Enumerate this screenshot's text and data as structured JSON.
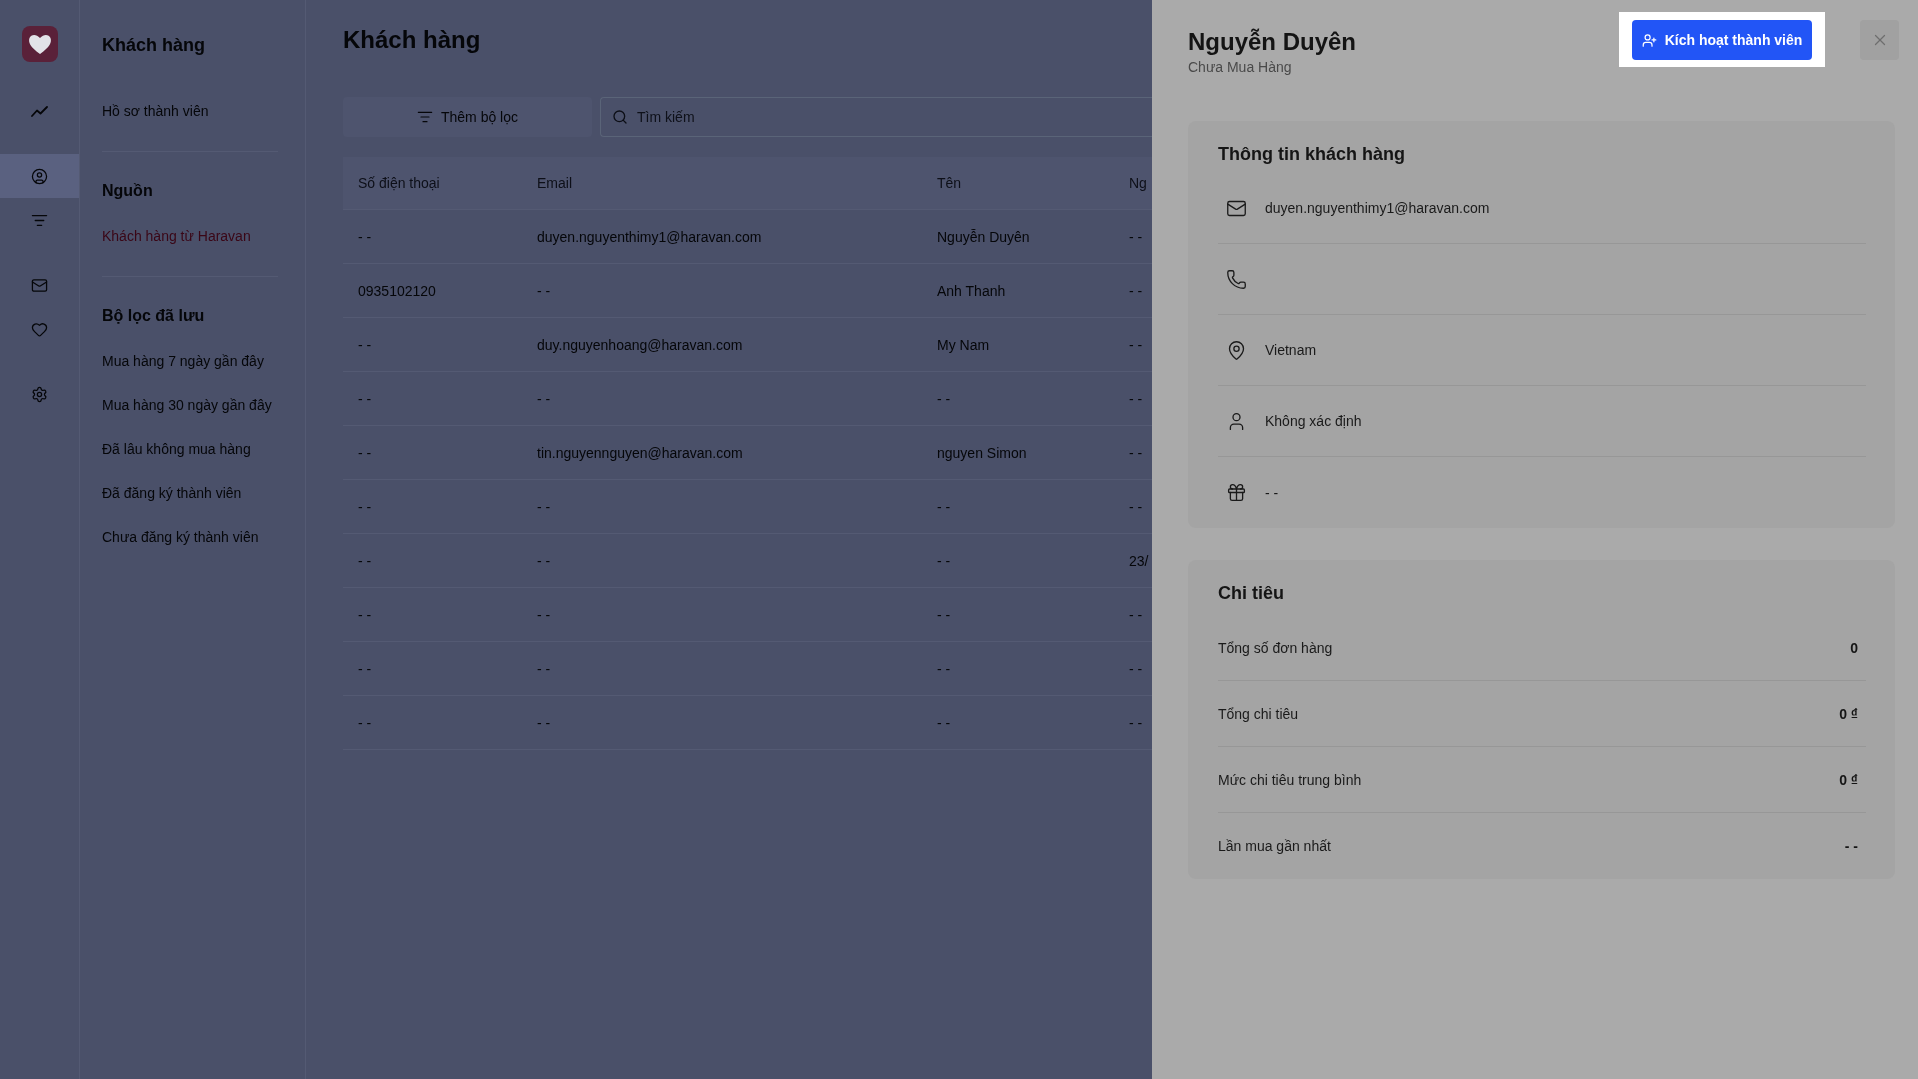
{
  "rail": {
    "groups": [
      {
        "items": [
          {
            "selected": false
          }
        ]
      },
      {
        "items": [
          {
            "selected": true
          },
          {
            "selected": false
          }
        ]
      },
      {
        "items": [
          {
            "selected": false
          },
          {
            "selected": false
          }
        ]
      },
      {
        "items": [
          {
            "selected": false
          }
        ]
      }
    ]
  },
  "nav": {
    "title": "Khách hàng",
    "sections": [
      {
        "items": [
          {
            "label": "Hồ sơ thành viên",
            "selected": false
          }
        ]
      },
      {
        "heading": "Nguồn",
        "items": [
          {
            "label": "Khách hàng từ Haravan",
            "selected": true
          }
        ]
      },
      {
        "heading": "Bộ lọc đã lưu",
        "items": [
          {
            "label": "Mua hàng 7 ngày gần đây",
            "selected": false
          },
          {
            "label": "Mua hàng 30 ngày gần đây",
            "selected": false
          },
          {
            "label": "Đã lâu không mua hàng",
            "selected": false
          },
          {
            "label": "Đã đăng ký thành viên",
            "selected": false
          },
          {
            "label": "Chưa đăng ký thành viên",
            "selected": false
          }
        ]
      }
    ]
  },
  "main": {
    "title": "Khách hàng",
    "filter_button": "Thêm bộ lọc",
    "search": {
      "placeholder": "Tìm kiếm"
    },
    "table": {
      "columns": [
        "Số điện thoại",
        "Email",
        "Tên",
        "Ng"
      ],
      "rows": [
        [
          "- -",
          "duyen.nguyenthimy1@haravan.com",
          "Nguyễn Duyên",
          "- -"
        ],
        [
          "0935102120",
          "- -",
          "Anh Thanh",
          "- -"
        ],
        [
          "- -",
          "duy.nguyenhoang@haravan.com",
          "My Nam",
          "- -"
        ],
        [
          "- -",
          "- -",
          "- -",
          "- -"
        ],
        [
          "- -",
          "tin.nguyennguyen@haravan.com",
          "nguyen Simon",
          "- -"
        ],
        [
          "- -",
          "- -",
          "- -",
          "- -"
        ],
        [
          "- -",
          "- -",
          "- -",
          "23/"
        ],
        [
          "- -",
          "- -",
          "- -",
          "- -"
        ],
        [
          "- -",
          "- -",
          "- -",
          "- -"
        ],
        [
          "- -",
          "- -",
          "- -",
          "- -"
        ]
      ]
    }
  },
  "drawer": {
    "title": "Nguyễn Duyên",
    "subtitle": "Chưa Mua Hàng",
    "activate_button": {
      "label": "Kích hoạt thành viên",
      "highlighted": true
    },
    "info_card": {
      "title": "Thông tin khách hàng",
      "rows": [
        {
          "kind": "email",
          "value": "duyen.nguyenthimy1@haravan.com"
        },
        {
          "kind": "phone"
        },
        {
          "kind": "location",
          "value": "Vietnam"
        },
        {
          "kind": "person",
          "value": "Không xác định"
        },
        {
          "kind": "gift",
          "value": "- -"
        }
      ]
    },
    "spending_card": {
      "title": "Chi tiêu",
      "rows": [
        {
          "label": "Tổng số đơn hàng",
          "value": "0"
        },
        {
          "label": "Tổng chi tiêu",
          "value": "0 ₫"
        },
        {
          "label": "Mức chi tiêu trung bình",
          "value": "0 ₫"
        },
        {
          "label": "Lần mua gần nhất",
          "value": "- -"
        }
      ]
    }
  }
}
